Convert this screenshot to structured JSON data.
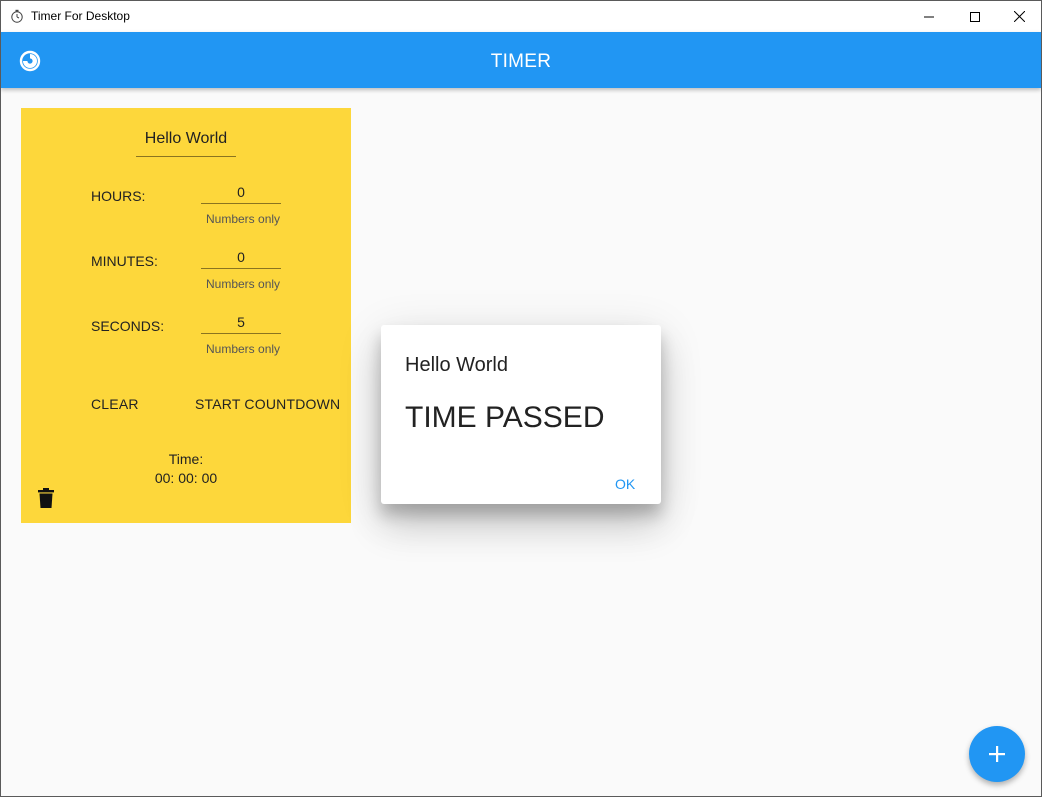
{
  "window": {
    "title": "Timer For Desktop",
    "icons": {
      "app": "stopwatch-icon",
      "minimize": "minimize-icon",
      "maximize": "maximize-icon",
      "close": "close-icon"
    }
  },
  "appbar": {
    "title": "TIMER",
    "logo_icon": "timer-logo-icon",
    "color": "#2196f3"
  },
  "card": {
    "color": "#fdd73b",
    "name": "Hello World",
    "fields": [
      {
        "label": "HOURS:",
        "value": "0",
        "helper": "Numbers only"
      },
      {
        "label": "MINUTES:",
        "value": "0",
        "helper": "Numbers only"
      },
      {
        "label": "SECONDS:",
        "value": "5",
        "helper": "Numbers only"
      }
    ],
    "clear_label": "CLEAR",
    "start_label": "START COUNTDOWN",
    "time_label": "Time:",
    "time_value": "00: 00: 00",
    "delete_icon": "trash-icon"
  },
  "dialog": {
    "title": "Hello World",
    "content": "TIME PASSED",
    "ok_label": "OK"
  },
  "fab": {
    "icon": "plus-icon"
  }
}
